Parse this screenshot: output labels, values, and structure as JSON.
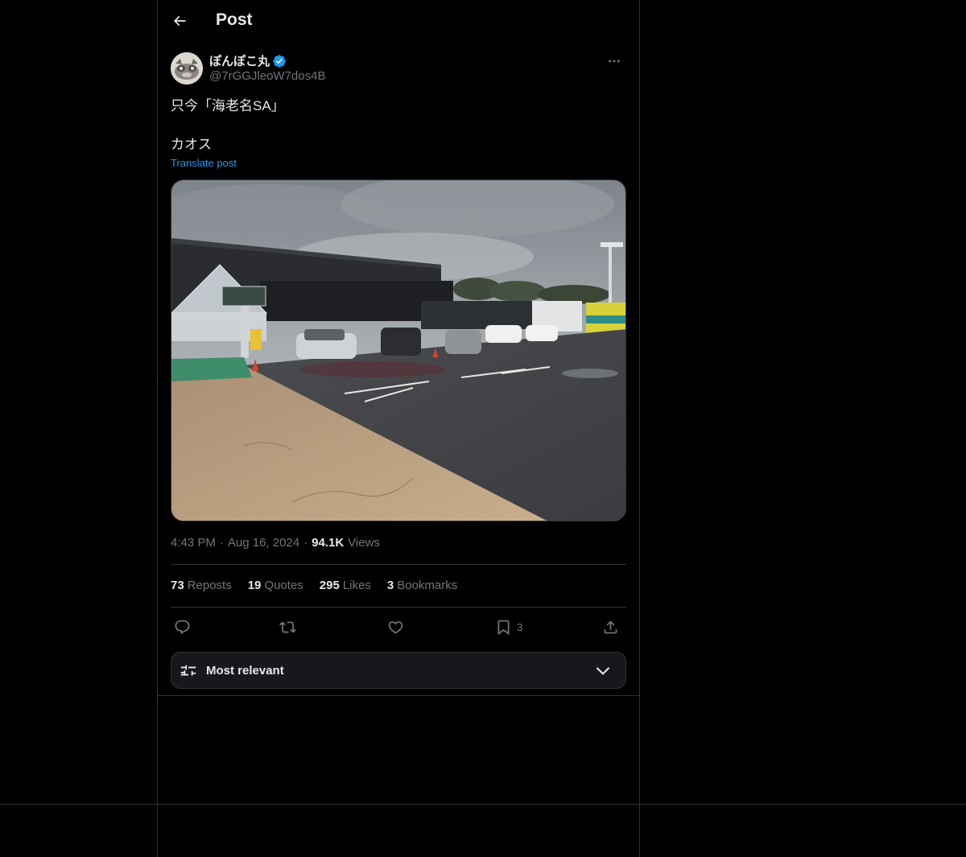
{
  "header": {
    "title": "Post"
  },
  "author": {
    "display_name": "ぽんぽこ丸",
    "handle": "@7rGGJleoW7dos4B",
    "verified": true
  },
  "post": {
    "lines": [
      "只今「海老名SA」",
      "カオス"
    ],
    "translate_label": "Translate post"
  },
  "meta": {
    "time": "4:43 PM",
    "separator": "·",
    "date": "Aug 16, 2024",
    "views_count": "94.1K",
    "views_label": "Views"
  },
  "stats": [
    {
      "count": "73",
      "label": "Reposts"
    },
    {
      "count": "19",
      "label": "Quotes"
    },
    {
      "count": "295",
      "label": "Likes"
    },
    {
      "count": "3",
      "label": "Bookmarks"
    }
  ],
  "actions": {
    "bookmark_count": "3"
  },
  "sort": {
    "label": "Most relevant"
  },
  "colors": {
    "background": "#000000",
    "border": "#2f3336",
    "text_primary": "#e7e9ea",
    "text_secondary": "#71767b",
    "accent": "#1d9bf0"
  },
  "icons": [
    "back-arrow-icon",
    "verified-badge-icon",
    "more-icon",
    "reply-icon",
    "repost-icon",
    "like-icon",
    "bookmark-icon",
    "share-icon",
    "sort-sliders-icon",
    "chevron-down-icon"
  ]
}
